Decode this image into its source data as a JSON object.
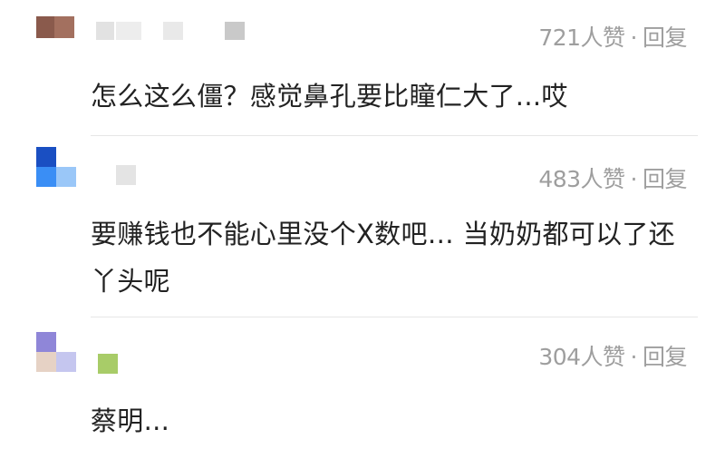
{
  "comments": [
    {
      "likes": "721人赞",
      "separator": "·",
      "reply": "回复",
      "text": "怎么这么僵？感觉鼻孔要比瞳仁大了...哎",
      "avatar_colors": [
        "#8a5a4c",
        "#a3705f",
        "#b8b8b8"
      ],
      "name_colors": [
        "#e2e2e2",
        "#ededed",
        "#c9c9c9"
      ]
    },
    {
      "likes": "483人赞",
      "separator": "·",
      "reply": "回复",
      "text": "要赚钱也不能心里没个X数吧… 当奶奶都可以了还丫头呢",
      "avatar_colors": [
        "#1a4fc2",
        "#3a8ef5",
        "#9ac7f8"
      ],
      "name_colors": [
        "#e4e4e4"
      ]
    },
    {
      "likes": "304人赞",
      "separator": "·",
      "reply": "回复",
      "text": "蔡明...",
      "avatar_colors": [
        "#8f86d8",
        "#e6d2c5",
        "#c5c6ef"
      ],
      "name_colors": [
        "#a8cc68"
      ]
    }
  ]
}
